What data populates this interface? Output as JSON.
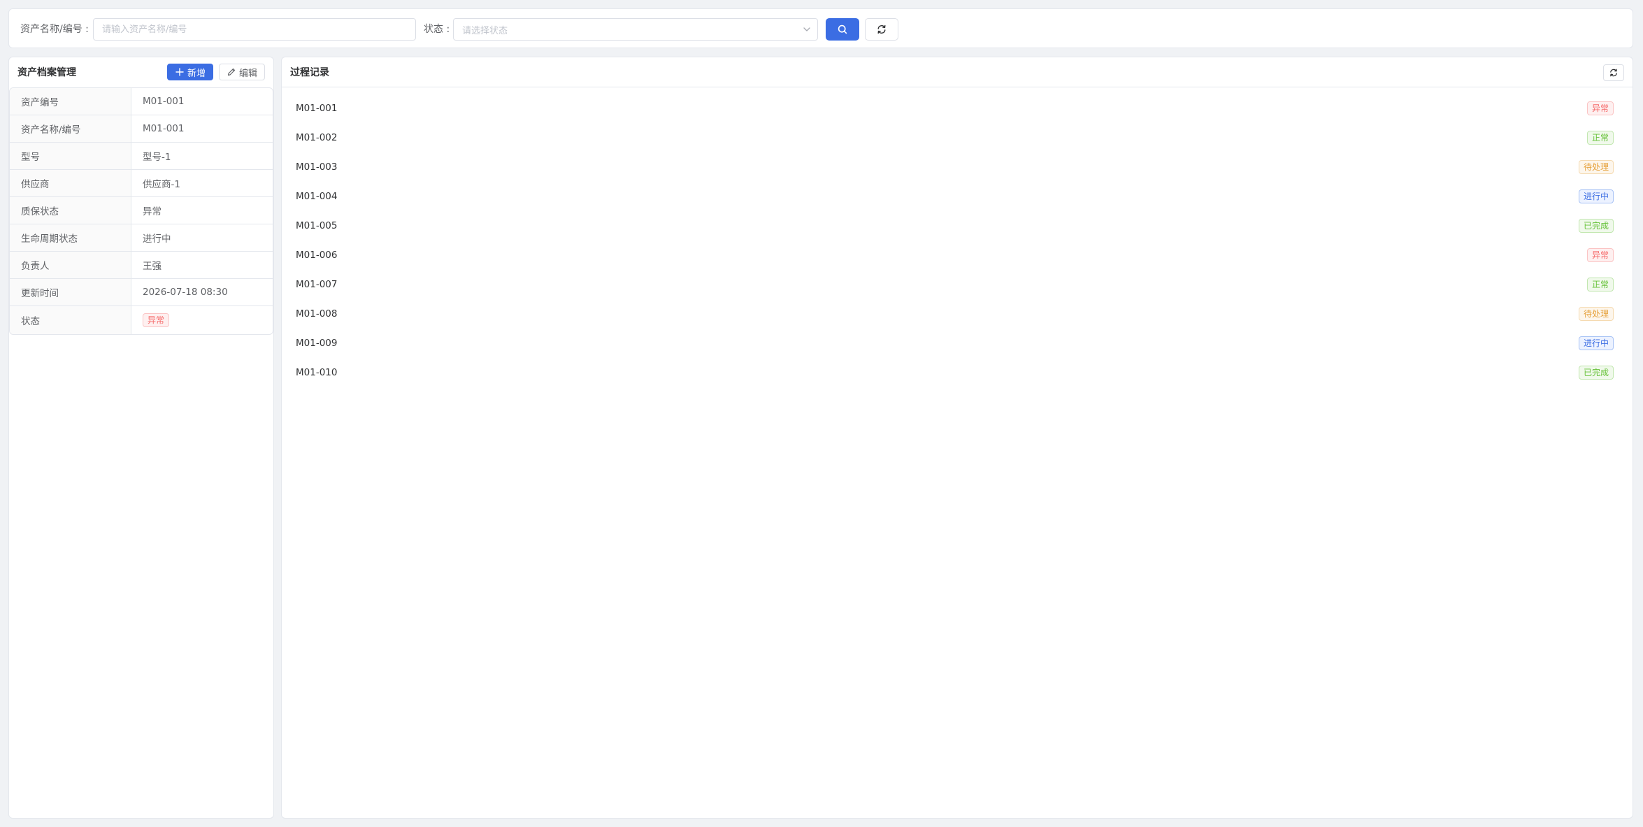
{
  "search": {
    "name_label": "资产名称/编号 :",
    "name_placeholder": "请输入资产名称/编号",
    "status_label": "状态 :",
    "status_placeholder": "请选择状态"
  },
  "left_panel": {
    "title": "资产档案管理",
    "add_label": "新增",
    "edit_label": "编辑",
    "details": [
      {
        "key": "资产编号",
        "value": "M01-001"
      },
      {
        "key": "资产名称/编号",
        "value": "M01-001"
      },
      {
        "key": "型号",
        "value": "型号-1"
      },
      {
        "key": "供应商",
        "value": "供应商-1"
      },
      {
        "key": "质保状态",
        "value": "异常"
      },
      {
        "key": "生命周期状态",
        "value": "进行中"
      },
      {
        "key": "负责人",
        "value": "王强"
      },
      {
        "key": "更新时间",
        "value": "2026-07-18 08:30"
      },
      {
        "key": "状态",
        "value": "异常",
        "tag_color": "red"
      }
    ]
  },
  "right_panel": {
    "title": "过程记录",
    "records": [
      {
        "id": "M01-001",
        "status": "异常",
        "tag_color": "red"
      },
      {
        "id": "M01-002",
        "status": "正常",
        "tag_color": "green"
      },
      {
        "id": "M01-003",
        "status": "待处理",
        "tag_color": "orange"
      },
      {
        "id": "M01-004",
        "status": "进行中",
        "tag_color": "blue"
      },
      {
        "id": "M01-005",
        "status": "已完成",
        "tag_color": "green"
      },
      {
        "id": "M01-006",
        "status": "异常",
        "tag_color": "red"
      },
      {
        "id": "M01-007",
        "status": "正常",
        "tag_color": "green"
      },
      {
        "id": "M01-008",
        "status": "待处理",
        "tag_color": "orange"
      },
      {
        "id": "M01-009",
        "status": "进行中",
        "tag_color": "blue"
      },
      {
        "id": "M01-010",
        "status": "已完成",
        "tag_color": "green"
      }
    ]
  },
  "colors": {
    "primary": "#3b6de3",
    "red": "#f56c6c",
    "green": "#67c23a",
    "orange": "#e6a23c",
    "blue": "#3b6de3"
  },
  "icons": {
    "search_button": "search-icon",
    "reset_button": "refresh-icon",
    "add_button": "plus-icon",
    "edit_button": "pencil-icon",
    "refresh_button": "refresh-icon",
    "select": "chevron-down-icon"
  }
}
